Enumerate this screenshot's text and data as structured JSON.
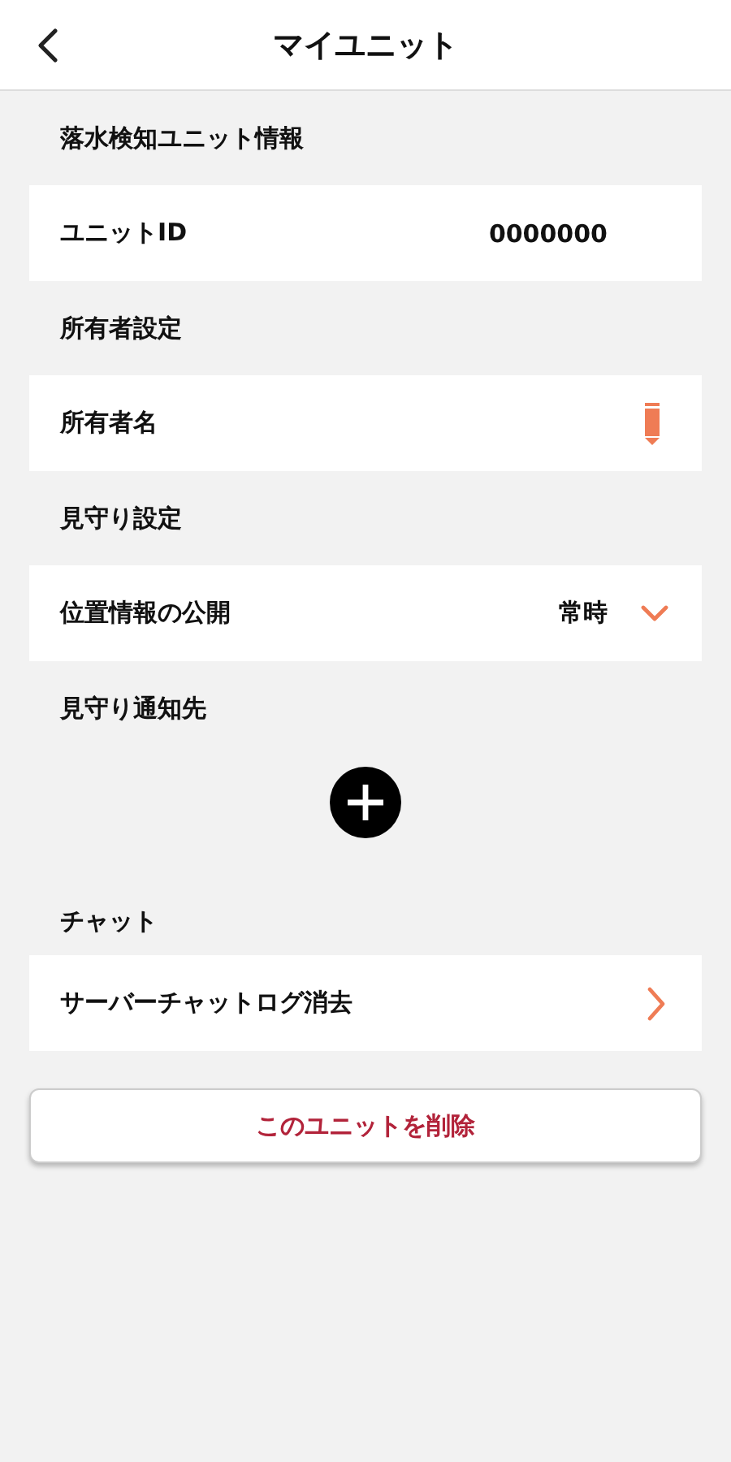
{
  "header": {
    "title": "マイユニット"
  },
  "sections": [
    {
      "heading": "落水検知ユニット情報",
      "kind": "value",
      "label": "ユニットID",
      "value": "0000000"
    },
    {
      "heading": "所有者設定",
      "kind": "edit",
      "label": "所有者名"
    },
    {
      "heading": "見守り設定",
      "kind": "dropdown",
      "label": "位置情報の公開",
      "value": "常時"
    },
    {
      "heading": "見守り通知先",
      "kind": "add"
    },
    {
      "heading": "チャット",
      "kind": "link",
      "label": "サーバーチャットログ消去"
    }
  ],
  "delete_button": "このユニットを削除"
}
